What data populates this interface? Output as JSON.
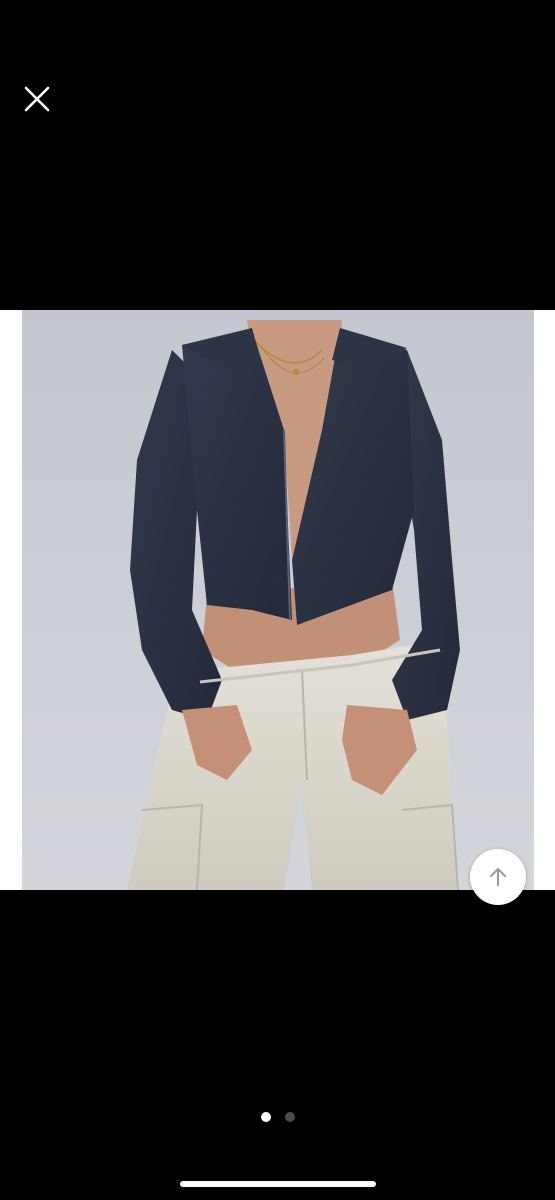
{
  "viewer": {
    "close_icon": "close-icon",
    "scroll_top_icon": "arrow-up-icon",
    "pager": {
      "total": 2,
      "current": 1
    },
    "colors": {
      "background": "#000000",
      "backdrop": "#c9ccd3",
      "jacket": "#2b3244",
      "pants": "#dcd9d0",
      "skin": "#c99a82"
    }
  }
}
